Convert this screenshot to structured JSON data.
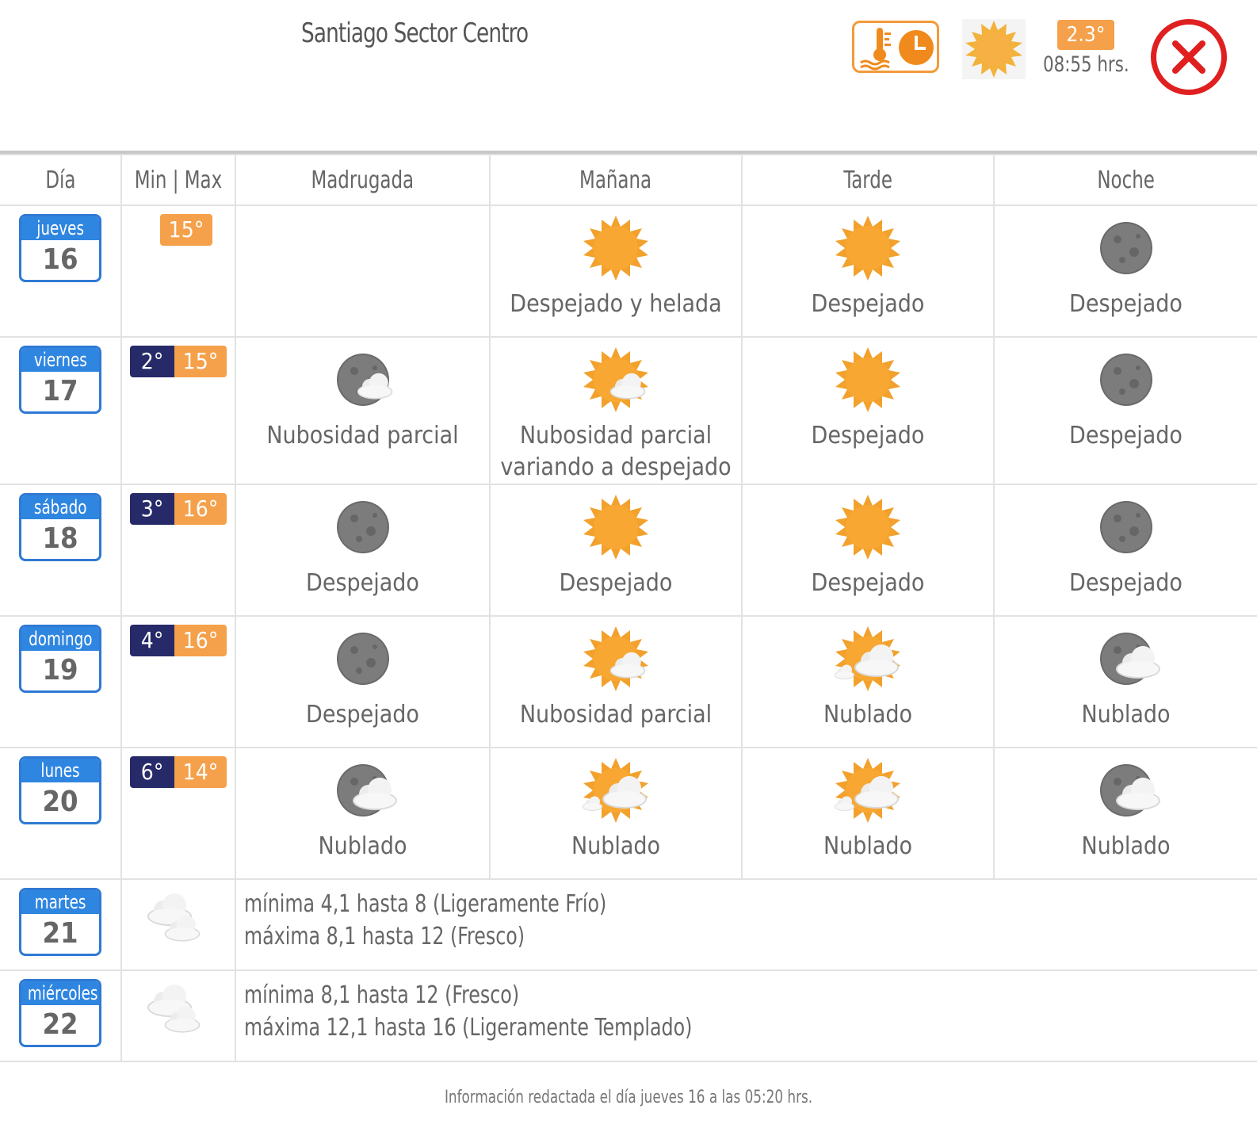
{
  "header": {
    "title": "Santiago Sector Centro",
    "current_temp": "2.3°",
    "current_time": "08:55 hrs.",
    "history_icon": "thermometer-clock-icon",
    "current_icon": "sun-icon",
    "close_icon": "close-icon"
  },
  "columns": [
    "Día",
    "Min | Max",
    "Madrugada",
    "Mañana",
    "Tarde",
    "Noche"
  ],
  "days": [
    {
      "name": "jueves",
      "num": "16",
      "min": "",
      "max": "15°",
      "periods": [
        {
          "icon": "",
          "label": ""
        },
        {
          "icon": "sun",
          "label": "Despejado y helada"
        },
        {
          "icon": "sun",
          "label": "Despejado"
        },
        {
          "icon": "moon",
          "label": "Despejado"
        }
      ]
    },
    {
      "name": "viernes",
      "num": "17",
      "min": "2°",
      "max": "15°",
      "periods": [
        {
          "icon": "moon-cloud",
          "label": "Nubosidad parcial"
        },
        {
          "icon": "sun-cloud",
          "label": "Nubosidad parcial variando a despejado"
        },
        {
          "icon": "sun",
          "label": "Despejado"
        },
        {
          "icon": "moon",
          "label": "Despejado"
        }
      ]
    },
    {
      "name": "sábado",
      "num": "18",
      "min": "3°",
      "max": "16°",
      "periods": [
        {
          "icon": "moon",
          "label": "Despejado"
        },
        {
          "icon": "sun",
          "label": "Despejado"
        },
        {
          "icon": "sun",
          "label": "Despejado"
        },
        {
          "icon": "moon",
          "label": "Despejado"
        }
      ]
    },
    {
      "name": "domingo",
      "num": "19",
      "min": "4°",
      "max": "16°",
      "periods": [
        {
          "icon": "moon",
          "label": "Despejado"
        },
        {
          "icon": "sun-cloud",
          "label": "Nubosidad parcial"
        },
        {
          "icon": "sun-clouds",
          "label": "Nublado"
        },
        {
          "icon": "moon-clouds",
          "label": "Nublado"
        }
      ]
    },
    {
      "name": "lunes",
      "num": "20",
      "min": "6°",
      "max": "14°",
      "periods": [
        {
          "icon": "moon-clouds",
          "label": "Nublado"
        },
        {
          "icon": "sun-clouds",
          "label": "Nublado"
        },
        {
          "icon": "sun-clouds",
          "label": "Nublado"
        },
        {
          "icon": "moon-clouds",
          "label": "Nublado"
        }
      ]
    }
  ],
  "extended": [
    {
      "name": "martes",
      "num": "21",
      "icon": "clouds",
      "line1": "mínima 4,1 hasta 8 (Ligeramente Frío)",
      "line2": "máxima 8,1 hasta 12 (Fresco)"
    },
    {
      "name": "miércoles",
      "num": "22",
      "icon": "clouds",
      "line1": "mínima 8,1 hasta 12 (Fresco)",
      "line2": "máxima 12,1 hasta 16 (Ligeramente Templado)"
    }
  ],
  "footer": "Información redactada el día jueves 16 a las 05:20 hrs.",
  "colors": {
    "day_blue": "#2f86e0",
    "min_navy": "#262a68",
    "max_orange": "#f5a04a",
    "close_red": "#e02020"
  }
}
